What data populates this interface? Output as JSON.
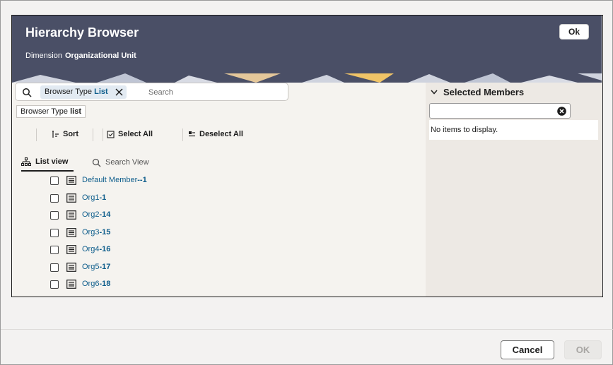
{
  "dialog": {
    "title": "Hierarchy Browser",
    "dimension_label": "Dimension",
    "dimension_value": "Organizational Unit",
    "ok_top_label": "Ok"
  },
  "search": {
    "chip_prefix": "Browser Type",
    "chip_value": "List",
    "placeholder": "Search"
  },
  "filter_chip": {
    "prefix": "Browser Type",
    "value": "list"
  },
  "toolbar": {
    "sort_label": "Sort",
    "select_all_label": "Select All",
    "deselect_all_label": "Deselect All"
  },
  "tabs": [
    {
      "label": "List view",
      "active": true
    },
    {
      "label": "Search View",
      "active": false
    }
  ],
  "members": [
    {
      "name": "Default Member",
      "id": "--1"
    },
    {
      "name": "Org1",
      "id": "-1"
    },
    {
      "name": "Org2",
      "id": "-14"
    },
    {
      "name": "Org3",
      "id": "-15"
    },
    {
      "name": "Org4",
      "id": "-16"
    },
    {
      "name": "Org5",
      "id": "-17"
    },
    {
      "name": "Org6",
      "id": "-18"
    }
  ],
  "selected_members": {
    "title": "Selected Members",
    "empty_text": "No items to display."
  },
  "footer": {
    "cancel_label": "Cancel",
    "ok_label": "OK"
  },
  "colors": {
    "header_bg": "#4a4f66",
    "link": "#0f5e8c",
    "left_panel_bg": "#f5f3ef",
    "right_panel_bg": "#ede9e4"
  }
}
